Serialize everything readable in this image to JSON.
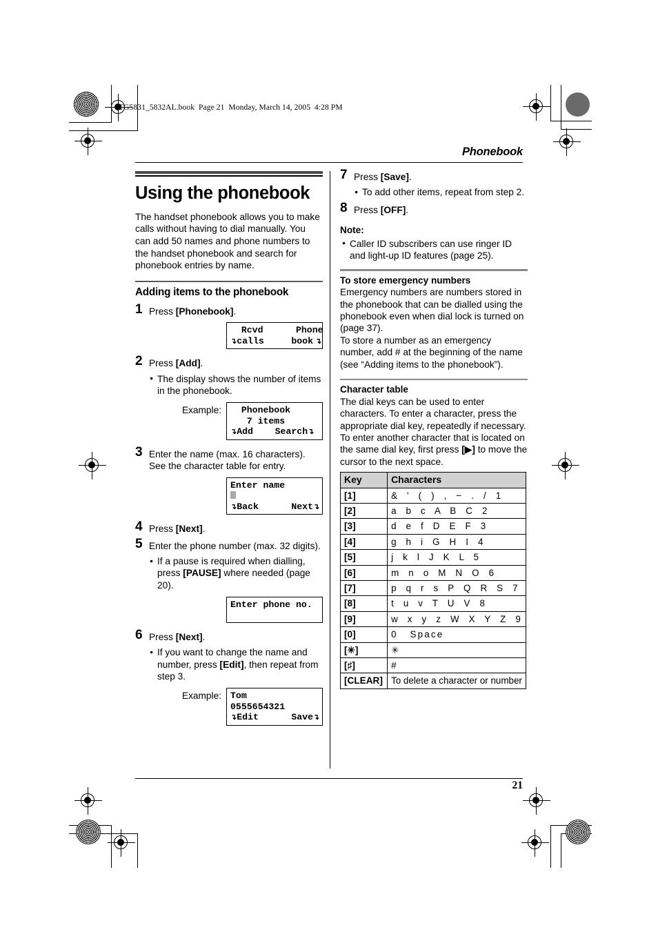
{
  "file_stamp": "TG5831_5832AL.book  Page 21  Monday, March 14, 2005  4:28 PM",
  "running_head": "Phonebook",
  "folio": "21",
  "left_column": {
    "title": "Using the phonebook",
    "intro": "The handset phonebook allows you to make calls without having to dial manually. You can add 50 names and phone numbers to the handset phonebook and search for phonebook entries by name.",
    "sub_head": "Adding items to the phonebook",
    "steps": [
      {
        "num": "1",
        "text_before": "Press ",
        "key": "[Phonebook]",
        "text_after": "."
      },
      {
        "num": "2",
        "text_before": "Press ",
        "key": "[Add]",
        "text_after": ".",
        "bullets": [
          "The display shows the number of items in the phonebook."
        ]
      },
      {
        "num": "3",
        "text_plain": "Enter the name (max. 16 characters). See the character table for entry."
      },
      {
        "num": "4",
        "text_before": "Press ",
        "key": "[Next]",
        "text_after": "."
      },
      {
        "num": "5",
        "text_plain": "Enter the phone number (max. 32 digits).",
        "bullets_rich": [
          {
            "a": "If a pause is required when dialling, press ",
            "key": "[PAUSE]",
            "b": " where needed (page 20)."
          }
        ]
      },
      {
        "num": "6",
        "text_before": "Press ",
        "key": "[Next]",
        "text_after": ".",
        "bullets_rich": [
          {
            "a": "If you want to change the name and number, press ",
            "key": "[Edit]",
            "b": ", then repeat from step 3."
          }
        ]
      }
    ],
    "lcd_1": {
      "label": "",
      "line1": "  Rcvd      Phone",
      "line2": "calls     book",
      "softkey_left": "↓",
      "softkey_right": "↓"
    },
    "lcd_2": {
      "label": "Example:",
      "line1": "  Phonebook",
      "line2": "   7 items",
      "line3_left": "Add",
      "line3_right": "Search"
    },
    "lcd_3": {
      "label": "",
      "line1": "Enter name",
      "line2_cursor": true,
      "line3_left": "Back",
      "line3_right": "Next"
    },
    "lcd_4": {
      "label": "",
      "line1": "Enter phone no.",
      "line2": ""
    },
    "lcd_5": {
      "label": "Example:",
      "line1": "Tom",
      "line2": "0555654321",
      "line3_left": "Edit",
      "line3_right": "Save"
    }
  },
  "right_column": {
    "steps": [
      {
        "num": "7",
        "text_before": "Press ",
        "key": "[Save]",
        "text_after": ".",
        "bullets": [
          "To add other items, repeat from step 2."
        ]
      },
      {
        "num": "8",
        "text_before": "Press ",
        "key": "[OFF]",
        "text_after": "."
      }
    ],
    "note_head": "Note:",
    "note_bullets": [
      "Caller ID subscribers can use ringer ID and light-up ID features (page 25)."
    ],
    "emergency_head": "To store emergency numbers",
    "emergency_p1": "Emergency numbers are numbers stored in the phonebook that can be dialled using the phonebook even when dial lock is turned on (page 37).",
    "emergency_p2": "To store a number as an emergency number, add # at the beginning of the name (see “Adding items to the phonebook”).",
    "chartable_head": "Character table",
    "chartable_intro_a": "The dial keys can be used to enter characters. To enter a character, press the appropriate dial key, repeatedly if necessary. To enter another character that is located on the same dial key, first press ",
    "chartable_intro_key": "[▶]",
    "chartable_intro_b": " to move the cursor to the next space.",
    "table": {
      "headers": [
        "Key",
        "Characters"
      ],
      "rows": [
        {
          "key": "[1]",
          "chars": "&  '  (  )  ,  −  .  /  1",
          "wide": false
        },
        {
          "key": "[2]",
          "chars": "a  b  c  A  B  C  2",
          "wide": false
        },
        {
          "key": "[3]",
          "chars": "d  e  f  D  E  F  3",
          "wide": false
        },
        {
          "key": "[4]",
          "chars": "g  h  i  G  H  I  4",
          "wide": false
        },
        {
          "key": "[5]",
          "chars": "j  k  l  J  K  L  5",
          "wide": false
        },
        {
          "key": "[6]",
          "chars": "m  n  o  M  N  O  6",
          "wide": false
        },
        {
          "key": "[7]",
          "chars": "p  q  r  s  P  Q  R  S  7",
          "wide": false
        },
        {
          "key": "[8]",
          "chars": "t  u  v  T  U  V  8",
          "wide": false
        },
        {
          "key": "[9]",
          "chars": "w  x  y  z  W  X  Y  Z  9",
          "wide": false
        },
        {
          "key": "[0]",
          "chars": "0   Space",
          "wide": false
        },
        {
          "key": "[✳]",
          "chars": "✳",
          "wide": false
        },
        {
          "key": "[♯]",
          "chars": "#",
          "wide": false
        },
        {
          "key": "[CLEAR]",
          "chars": "To delete a character or number",
          "wide": true
        }
      ]
    }
  }
}
